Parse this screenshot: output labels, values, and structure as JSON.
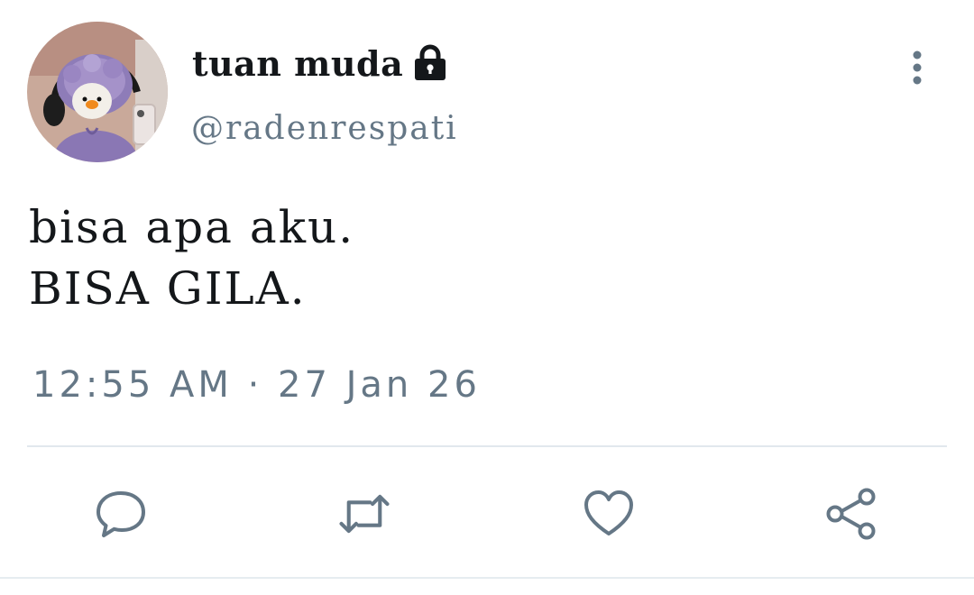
{
  "user": {
    "display_name": "tuan muda",
    "handle": "@radenrespati",
    "protected_icon": "lock-icon",
    "avatar_icon": "avatar"
  },
  "tweet": {
    "lines": [
      "bisa apa aku.",
      "BISA GILA."
    ],
    "timestamp": "12:55 AM · 27 Jan 26"
  },
  "actions": [
    {
      "name": "reply",
      "icon": "comment-icon"
    },
    {
      "name": "retweet",
      "icon": "retweet-icon"
    },
    {
      "name": "like",
      "icon": "heart-icon"
    },
    {
      "name": "share",
      "icon": "share-icon"
    }
  ],
  "colors": {
    "text": "#14171a",
    "secondary": "#657786",
    "divider": "#e1e8ed",
    "background": "#ffffff"
  }
}
